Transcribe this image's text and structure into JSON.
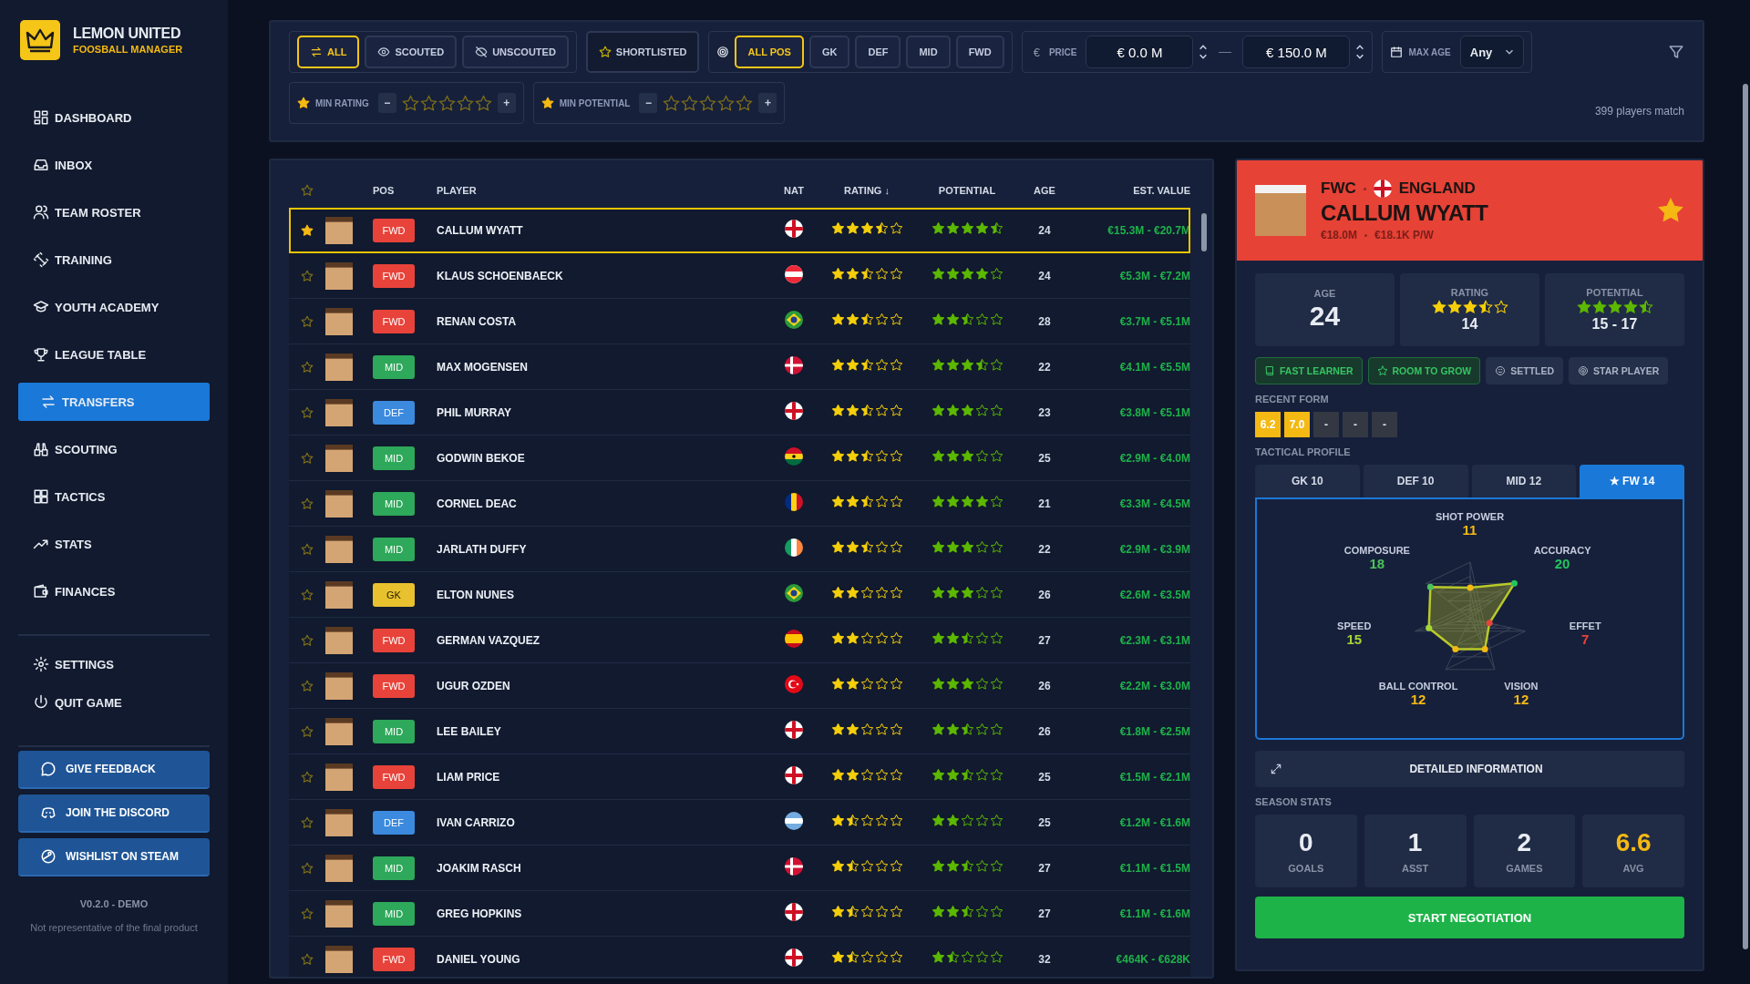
{
  "brand": {
    "title": "LEMON UNITED",
    "subtitle": "FOOSBALL MANAGER"
  },
  "sidebar": {
    "items": [
      {
        "label": "DASHBOARD",
        "selected": false
      },
      {
        "label": "INBOX",
        "selected": false
      },
      {
        "label": "TEAM ROSTER",
        "selected": false
      },
      {
        "label": "TRAINING",
        "selected": false
      },
      {
        "label": "YOUTH ACADEMY",
        "selected": false
      },
      {
        "label": "LEAGUE TABLE",
        "selected": false
      },
      {
        "label": "TRANSFERS",
        "selected": true
      },
      {
        "label": "SCOUTING",
        "selected": false
      },
      {
        "label": "TACTICS",
        "selected": false
      },
      {
        "label": "STATS",
        "selected": false
      },
      {
        "label": "FINANCES",
        "selected": false
      }
    ],
    "system_items": [
      {
        "label": "SETTINGS"
      },
      {
        "label": "QUIT GAME"
      }
    ],
    "links": [
      {
        "label": "GIVE FEEDBACK"
      },
      {
        "label": "JOIN THE DISCORD"
      },
      {
        "label": "WISHLIST ON STEAM"
      }
    ],
    "version": "V0.2.0 - DEMO",
    "disclaimer": "Not representative of the final product"
  },
  "filters": {
    "scout": [
      {
        "label": "ALL",
        "selected": true
      },
      {
        "label": "SCOUTED",
        "selected": false
      },
      {
        "label": "UNSCOUTED",
        "selected": false
      }
    ],
    "shortlisted": {
      "label": "SHORTLISTED",
      "selected": false
    },
    "positions": [
      {
        "label": "ALL POS",
        "selected": true
      },
      {
        "label": "GK",
        "selected": false
      },
      {
        "label": "DEF",
        "selected": false
      },
      {
        "label": "MID",
        "selected": false
      },
      {
        "label": "FWD",
        "selected": false
      }
    ],
    "price": {
      "symbol": "€",
      "label": "PRICE",
      "min": "€ 0.0 M",
      "max": "€ 150.0 M"
    },
    "max_age": {
      "label": "MAX AGE",
      "value": "Any"
    },
    "min_rating": {
      "label": "MIN RATING",
      "stars": 0,
      "minus": "−",
      "plus": "+"
    },
    "min_potential": {
      "label": "MIN POTENTIAL",
      "stars": 0,
      "minus": "−",
      "plus": "+"
    },
    "match_count": "399 players match"
  },
  "table": {
    "columns": [
      "POS",
      "PLAYER",
      "NAT",
      "RATING ↓",
      "POTENTIAL",
      "AGE",
      "EST. VALUE"
    ],
    "rows": [
      {
        "shortlisted": true,
        "selected": true,
        "pos": "FWD",
        "color": "#e8433a",
        "name": "CALLUM WYATT",
        "kind": "eng",
        "rating": {
          "stars": 3.5
        },
        "potential": {
          "stars": 4.5
        },
        "age": "24",
        "value": "€15.3M - €20.7M"
      },
      {
        "shortlisted": false,
        "selected": false,
        "pos": "FWD",
        "color": "#e8433a",
        "name": "KLAUS SCHOENBAECK",
        "kind": "aut",
        "rating": {
          "stars": 2.5
        },
        "potential": {
          "stars": 4
        },
        "age": "24",
        "value": "€5.3M - €7.2M"
      },
      {
        "shortlisted": false,
        "selected": false,
        "pos": "FWD",
        "color": "#e8433a",
        "name": "RENAN COSTA",
        "kind": "bra",
        "rating": {
          "stars": 2.5
        },
        "potential": {
          "stars": 2.5
        },
        "age": "28",
        "value": "€3.7M - €5.1M"
      },
      {
        "shortlisted": false,
        "selected": false,
        "pos": "MID",
        "color": "#2ea85a",
        "name": "MAX MOGENSEN",
        "kind": "den",
        "rating": {
          "stars": 2.5
        },
        "potential": {
          "stars": 3.5
        },
        "age": "22",
        "value": "€4.1M - €5.5M"
      },
      {
        "shortlisted": false,
        "selected": false,
        "pos": "DEF",
        "color": "#3b8ade",
        "name": "PHIL MURRAY",
        "kind": "eng",
        "rating": {
          "stars": 2.5
        },
        "potential": {
          "stars": 3
        },
        "age": "23",
        "value": "€3.8M - €5.1M"
      },
      {
        "shortlisted": false,
        "selected": false,
        "pos": "MID",
        "color": "#2ea85a",
        "name": "GODWIN BEKOE",
        "kind": "gha",
        "rating": {
          "stars": 2.5
        },
        "potential": {
          "stars": 3
        },
        "age": "25",
        "value": "€2.9M - €4.0M"
      },
      {
        "shortlisted": false,
        "selected": false,
        "pos": "MID",
        "color": "#2ea85a",
        "name": "CORNEL DEAC",
        "kind": "rou",
        "rating": {
          "stars": 2.5
        },
        "potential": {
          "stars": 4
        },
        "age": "21",
        "value": "€3.3M - €4.5M"
      },
      {
        "shortlisted": false,
        "selected": false,
        "pos": "MID",
        "color": "#2ea85a",
        "name": "JARLATH DUFFY",
        "kind": "irl",
        "rating": {
          "stars": 2.5
        },
        "potential": {
          "stars": 3
        },
        "age": "22",
        "value": "€2.9M - €3.9M"
      },
      {
        "shortlisted": false,
        "selected": false,
        "pos": "GK",
        "color": "#e8c22e",
        "name": "ELTON NUNES",
        "kind": "bra",
        "rating": {
          "stars": 2
        },
        "potential": {
          "stars": 3
        },
        "age": "26",
        "value": "€2.6M - €3.5M"
      },
      {
        "shortlisted": false,
        "selected": false,
        "pos": "FWD",
        "color": "#e8433a",
        "name": "GERMAN VAZQUEZ",
        "kind": "esp",
        "rating": {
          "stars": 2
        },
        "potential": {
          "stars": 2.5
        },
        "age": "27",
        "value": "€2.3M - €3.1M"
      },
      {
        "shortlisted": false,
        "selected": false,
        "pos": "FWD",
        "color": "#e8433a",
        "name": "UGUR OZDEN",
        "kind": "tur",
        "rating": {
          "stars": 2
        },
        "potential": {
          "stars": 3
        },
        "age": "26",
        "value": "€2.2M - €3.0M"
      },
      {
        "shortlisted": false,
        "selected": false,
        "pos": "MID",
        "color": "#2ea85a",
        "name": "LEE BAILEY",
        "kind": "eng",
        "rating": {
          "stars": 2
        },
        "potential": {
          "stars": 2.5
        },
        "age": "26",
        "value": "€1.8M - €2.5M"
      },
      {
        "shortlisted": false,
        "selected": false,
        "pos": "FWD",
        "color": "#e8433a",
        "name": "LIAM PRICE",
        "kind": "eng",
        "rating": {
          "stars": 2
        },
        "potential": {
          "stars": 2.5
        },
        "age": "25",
        "value": "€1.5M - €2.1M"
      },
      {
        "shortlisted": false,
        "selected": false,
        "pos": "DEF",
        "color": "#3b8ade",
        "name": "IVAN CARRIZO",
        "kind": "arg",
        "rating": {
          "stars": 1.5
        },
        "potential": {
          "stars": 2
        },
        "age": "25",
        "value": "€1.2M - €1.6M"
      },
      {
        "shortlisted": false,
        "selected": false,
        "pos": "MID",
        "color": "#2ea85a",
        "name": "JOAKIM RASCH",
        "kind": "den",
        "rating": {
          "stars": 1.5
        },
        "potential": {
          "stars": 2.5
        },
        "age": "27",
        "value": "€1.1M - €1.5M"
      },
      {
        "shortlisted": false,
        "selected": false,
        "pos": "MID",
        "color": "#2ea85a",
        "name": "GREG HOPKINS",
        "kind": "eng",
        "rating": {
          "stars": 1.5
        },
        "potential": {
          "stars": 2.5
        },
        "age": "27",
        "value": "€1.1M - €1.6M"
      },
      {
        "shortlisted": false,
        "selected": false,
        "pos": "FWD",
        "color": "#e8433a",
        "name": "DANIEL YOUNG",
        "kind": "eng",
        "rating": {
          "stars": 1.5
        },
        "potential": {
          "stars": 1.5
        },
        "age": "32",
        "value": "€464K - €628K"
      }
    ]
  },
  "detail": {
    "position": "FWC",
    "nation": "ENGLAND",
    "name": "CALLUM WYATT",
    "value": "€18.0M",
    "wage": "€18.1K P/W",
    "shortlisted": true,
    "age": {
      "label": "AGE",
      "value": "24"
    },
    "rating": {
      "label": "RATING",
      "stars": 3.5,
      "value": "14"
    },
    "potential": {
      "label": "POTENTIAL",
      "stars": 4.5,
      "value": "15 - 17"
    },
    "traits": [
      {
        "label": "FAST LEARNER",
        "kind": "positive"
      },
      {
        "label": "ROOM TO GROW",
        "kind": "positive"
      },
      {
        "label": "SETTLED",
        "kind": "neutral"
      },
      {
        "label": "STAR PLAYER",
        "kind": "neutral"
      }
    ],
    "recent_form_label": "RECENT FORM",
    "recent_form": [
      {
        "value": "6.2",
        "kind": "played"
      },
      {
        "value": "7.0",
        "kind": "played"
      },
      {
        "value": "-",
        "kind": "empty"
      },
      {
        "value": "-",
        "kind": "empty"
      },
      {
        "value": "-",
        "kind": "empty"
      }
    ],
    "tactical_label": "TACTICAL PROFILE",
    "tactical_tabs": [
      {
        "label": "GK 10",
        "selected": false
      },
      {
        "label": "DEF 10",
        "selected": false
      },
      {
        "label": "MID 12",
        "selected": false
      },
      {
        "label": "★ FW 14",
        "selected": true
      }
    ],
    "attributes": [
      {
        "label": "SHOT POWER",
        "value": "11",
        "color": "#f5b914"
      },
      {
        "label": "COMPOSURE",
        "value": "18",
        "color": "#4cc35a"
      },
      {
        "label": "ACCURACY",
        "value": "20",
        "color": "#22c55e"
      },
      {
        "label": "SPEED",
        "value": "15",
        "color": "#a3d636"
      },
      {
        "label": "EFFET",
        "value": "7",
        "color": "#e8433a"
      },
      {
        "label": "BALL CONTROL",
        "value": "12",
        "color": "#f5b914"
      },
      {
        "label": "VISION",
        "value": "12",
        "color": "#f5b914"
      }
    ],
    "detailed_button": "DETAILED INFORMATION",
    "season_label": "SEASON STATS",
    "season_stats": [
      {
        "value": "0",
        "label": "GOALS",
        "kind": "plain"
      },
      {
        "value": "1",
        "label": "ASST",
        "kind": "plain"
      },
      {
        "value": "2",
        "label": "GAMES",
        "kind": "plain"
      },
      {
        "value": "6.6",
        "label": "AVG",
        "kind": "highlight"
      }
    ],
    "negotiate_button": "START NEGOTIATION"
  }
}
